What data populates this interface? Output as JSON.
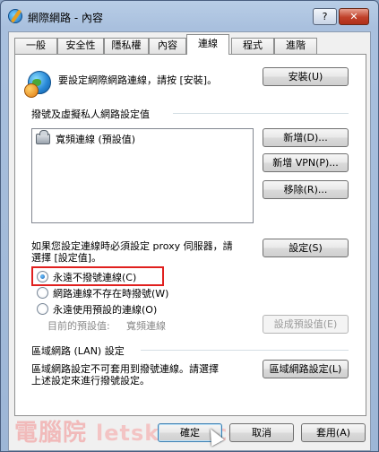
{
  "window": {
    "title": "網際網路 - 內容",
    "help_label": "?",
    "close_label": "✕"
  },
  "tabs": [
    {
      "label": "一般"
    },
    {
      "label": "安全性"
    },
    {
      "label": "隱私權"
    },
    {
      "label": "內容"
    },
    {
      "label": "連線",
      "active": true
    },
    {
      "label": "程式"
    },
    {
      "label": "進階"
    }
  ],
  "setup": {
    "text": "要設定網際網路連線，請按 [安裝]。",
    "button": "安裝(U)"
  },
  "dialup": {
    "group_title": "撥號及虛擬私人網路設定值",
    "list_items": [
      "寬頻連線 (預設值)"
    ],
    "add_button": "新增(D)...",
    "add_vpn_button": "新增 VPN(P)...",
    "remove_button": "移除(R)...",
    "proxy_text_line1": "如果您設定連線時必須設定 proxy 伺服器，請",
    "proxy_text_line2": "選擇 [設定值]。",
    "settings_button": "設定(S)",
    "options": [
      {
        "label": "永遠不撥號連線(C)",
        "checked": true
      },
      {
        "label": "網路連線不存在時撥號(W)",
        "checked": false
      },
      {
        "label": "永遠使用預設的連線(O)",
        "checked": false
      }
    ],
    "current_default_label": "目前的預設值:",
    "current_default_value": "寬頻連線",
    "set_default_button": "設成預設值(E)"
  },
  "lan": {
    "group_title": "區域網路 (LAN) 設定",
    "text_line1": "區域網路設定不可套用到撥號連線。請選擇",
    "text_line2": "上述設定來進行撥號設定。",
    "button": "區域網路設定(L)"
  },
  "footer": {
    "ok_button": "確定",
    "cancel_button": "取消",
    "apply_button": "套用(A)"
  },
  "watermark": {
    "cn": "電腦院",
    "en": "letskuso.com"
  },
  "colors": {
    "highlight_border": "#e0201e",
    "title_gradient": "#a9c0de"
  }
}
